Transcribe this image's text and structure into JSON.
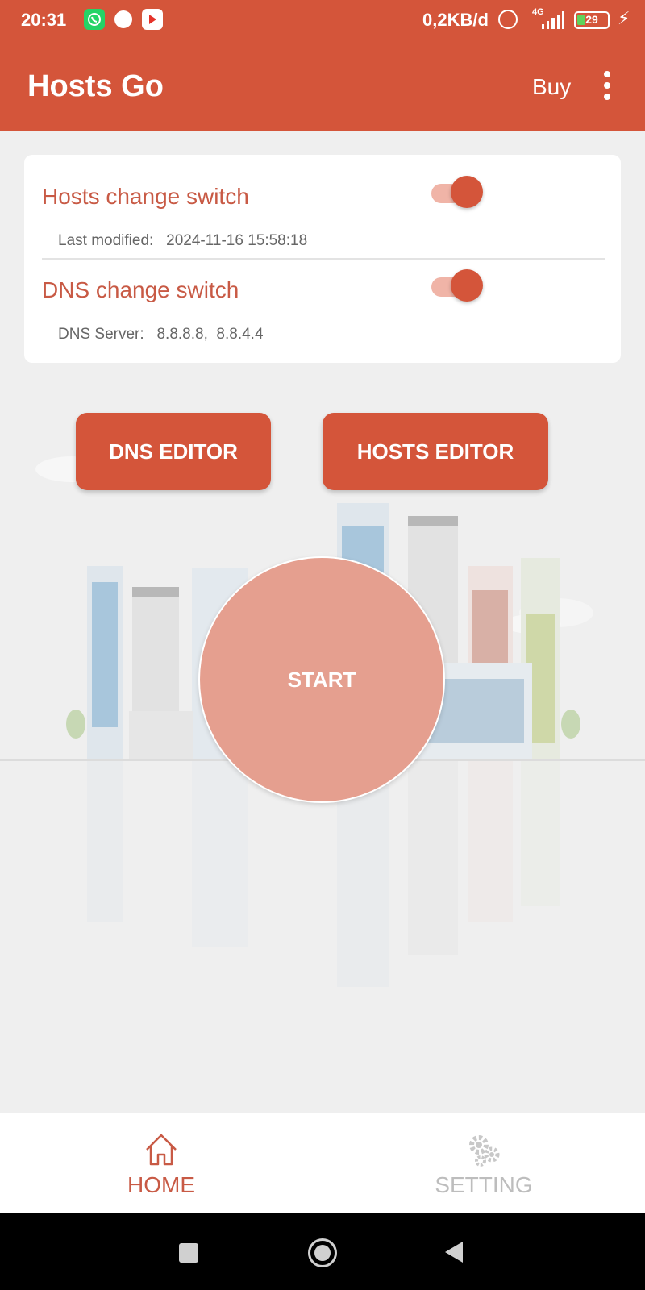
{
  "status_bar": {
    "time": "20:31",
    "data_rate": "0,2KB/d",
    "network_type": "4G",
    "battery": "29",
    "icons": [
      "whatsapp-icon",
      "app-icon",
      "youtube-icon",
      "alarm-icon",
      "signal-icon",
      "battery-icon",
      "charging-icon"
    ]
  },
  "app_bar": {
    "title": "Hosts Go",
    "buy_label": "Buy",
    "more_icon": "more-vert-icon"
  },
  "switches": {
    "hosts": {
      "label": "Hosts change switch",
      "on": true,
      "sub_label": "Last modified:",
      "sub_value": "2024-11-16 15:58:18"
    },
    "dns": {
      "label": "DNS change switch",
      "on": true,
      "sub_label": "DNS Server:",
      "sub_value": "8.8.8.8,  8.8.4.4"
    }
  },
  "buttons": {
    "dns_editor": "DNS EDITOR",
    "hosts_editor": "HOSTS EDITOR",
    "start": "START"
  },
  "bottom_nav": {
    "home": {
      "label": "HOME",
      "icon": "home-icon",
      "active": true
    },
    "setting": {
      "label": "SETTING",
      "icon": "gears-icon",
      "active": false
    }
  },
  "colors": {
    "primary": "#d4553a",
    "primary_light": "#f0b4a7",
    "start_circle": "#e59f8f",
    "text_accent": "#c85a45",
    "inactive": "#bdbdbd"
  }
}
